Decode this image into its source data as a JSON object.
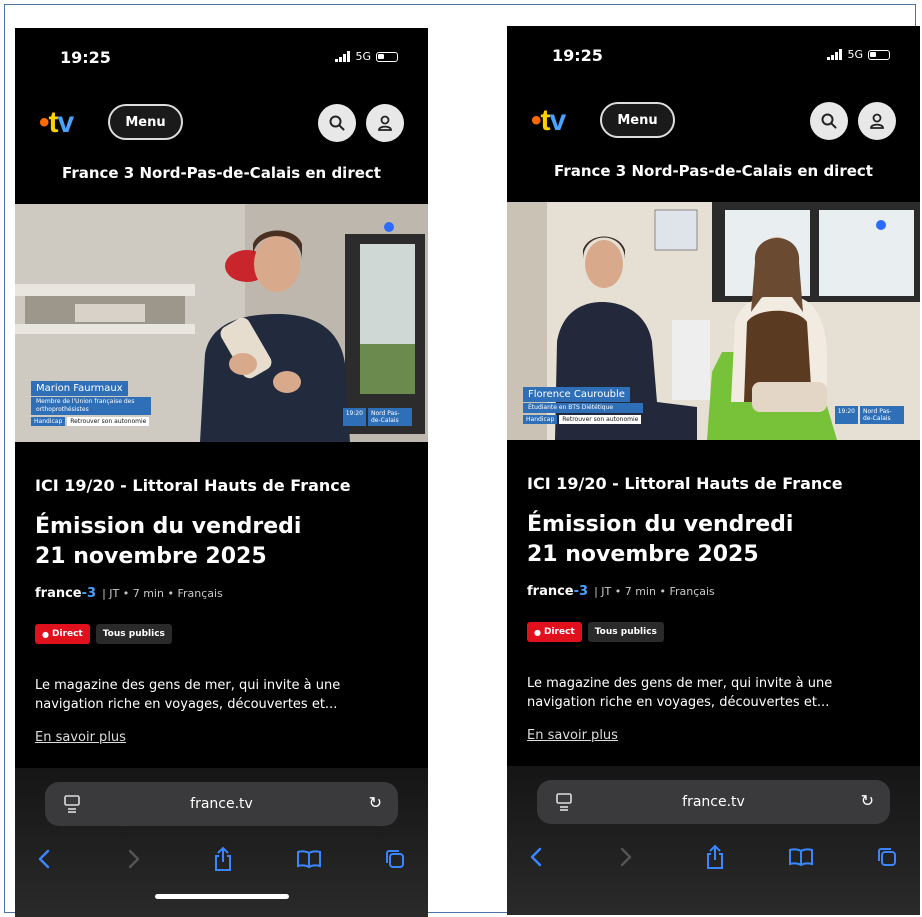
{
  "screens": [
    {
      "status": {
        "time": "19:25",
        "network": "5G"
      },
      "header": {
        "menu_label": "Menu"
      },
      "channel_title": "France 3 Nord-Pas-de-Calais en direct",
      "video": {
        "name": "Marion Faurmaux",
        "role": "Membre de l'Union française des orthoprothésistes",
        "tag1": "Handicap",
        "tag2": "Retrouver son autonomie",
        "time_badge": "19:20",
        "region_badge": "Nord Pas-de-Calais",
        "bg": "#b7b1a6"
      },
      "program": {
        "show": "ICI 19/20 - Littoral Hauts de France",
        "title_line1": "Émission du vendredi",
        "title_line2": "21 novembre 2025",
        "brand_a": "france",
        "brand_b": "-3",
        "meta": "|  JT  •  7 min  •  Français",
        "tag_direct": "Direct",
        "tag_public": "Tous publics",
        "description": "Le magazine des gens de mer, qui invite à une navigation riche en voyages, découvertes et...",
        "more_link": "En savoir plus"
      },
      "browser": {
        "url": "france.tv"
      }
    },
    {
      "status": {
        "time": "19:25",
        "network": "5G"
      },
      "header": {
        "menu_label": "Menu"
      },
      "channel_title": "France 3 Nord-Pas-de-Calais en direct",
      "video": {
        "name": "Florence Caurouble",
        "role": "Étudiante en BTS Diététique",
        "tag1": "Handicap",
        "tag2": "Retrouver son autonomie",
        "time_badge": "19:20",
        "region_badge": "Nord Pas-de-Calais",
        "bg": "#c9c3b8"
      },
      "program": {
        "show": "ICI 19/20 - Littoral Hauts de France",
        "title_line1": "Émission du vendredi",
        "title_line2": "21 novembre 2025",
        "brand_a": "france",
        "brand_b": "-3",
        "meta": "|  JT  •  7 min  •  Français",
        "tag_direct": "Direct",
        "tag_public": "Tous publics",
        "description": "Le magazine des gens de mer, qui invite à une navigation riche en voyages, découvertes et...",
        "more_link": "En savoir plus"
      },
      "browser": {
        "url": "france.tv"
      }
    }
  ]
}
